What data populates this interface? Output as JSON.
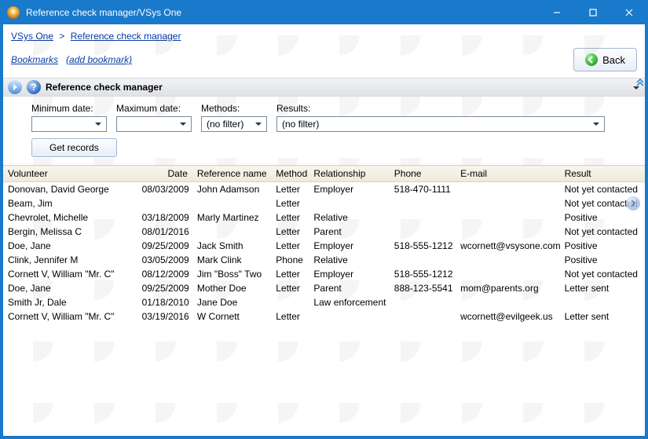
{
  "window": {
    "title": "Reference check manager/VSys One"
  },
  "breadcrumbs": {
    "root": "VSys One",
    "current": "Reference check manager"
  },
  "bookmarks": {
    "label": "Bookmarks",
    "add": "(add bookmark)"
  },
  "back_label": "Back",
  "section": {
    "title": "Reference check manager"
  },
  "filters": {
    "min_date": {
      "label": "Minimum date:",
      "value": ""
    },
    "max_date": {
      "label": "Maximum date:",
      "value": ""
    },
    "methods": {
      "label": "Methods:",
      "value": "(no filter)"
    },
    "results": {
      "label": "Results:",
      "value": "(no filter)"
    }
  },
  "get_records_label": "Get records",
  "columns": {
    "volunteer": "Volunteer",
    "date": "Date",
    "reference": "Reference name",
    "method": "Method",
    "relationship": "Relationship",
    "phone": "Phone",
    "email": "E-mail",
    "result": "Result"
  },
  "rows": [
    {
      "volunteer": "Donovan, David George",
      "date": "08/03/2009",
      "reference": "John Adamson",
      "method": "Letter",
      "relationship": "Employer",
      "phone": "518-470-1111",
      "email": "",
      "result": "Not yet contacted"
    },
    {
      "volunteer": "Beam, Jim",
      "date": "",
      "reference": "",
      "method": "Letter",
      "relationship": "",
      "phone": "",
      "email": "",
      "result": "Not yet contacted"
    },
    {
      "volunteer": "Chevrolet, Michelle",
      "date": "03/18/2009",
      "reference": "Marly Martinez",
      "method": "Letter",
      "relationship": "Relative",
      "phone": "",
      "email": "",
      "result": "Positive"
    },
    {
      "volunteer": "Bergin, Melissa C",
      "date": "08/01/2016",
      "reference": "",
      "method": "Letter",
      "relationship": "Parent",
      "phone": "",
      "email": "",
      "result": "Not yet contacted"
    },
    {
      "volunteer": "Doe, Jane",
      "date": "09/25/2009",
      "reference": "Jack Smith",
      "method": "Letter",
      "relationship": "Employer",
      "phone": "518-555-1212",
      "email": "wcornett@vsysone.com",
      "result": "Positive"
    },
    {
      "volunteer": "Clink, Jennifer M",
      "date": "03/05/2009",
      "reference": "Mark Clink",
      "method": "Phone",
      "relationship": "Relative",
      "phone": "",
      "email": "",
      "result": "Positive"
    },
    {
      "volunteer": "Cornett V, William \"Mr. C\"",
      "date": "08/12/2009",
      "reference": "Jim \"Boss\" Two",
      "method": "Letter",
      "relationship": "Employer",
      "phone": "518-555-1212",
      "email": "",
      "result": "Not yet contacted"
    },
    {
      "volunteer": "Doe, Jane",
      "date": "09/25/2009",
      "reference": "Mother Doe",
      "method": "Letter",
      "relationship": "Parent",
      "phone": "888-123-5541",
      "email": "mom@parents.org",
      "result": "Letter sent"
    },
    {
      "volunteer": "Smith Jr, Dale",
      "date": "01/18/2010",
      "reference": "Jane Doe",
      "method": "",
      "relationship": "Law enforcement",
      "phone": "",
      "email": "",
      "result": ""
    },
    {
      "volunteer": "Cornett V, William \"Mr. C\"",
      "date": "03/19/2016",
      "reference": "W Cornett",
      "method": "Letter",
      "relationship": "",
      "phone": "",
      "email": "wcornett@evilgeek.us",
      "result": "Letter sent"
    }
  ]
}
